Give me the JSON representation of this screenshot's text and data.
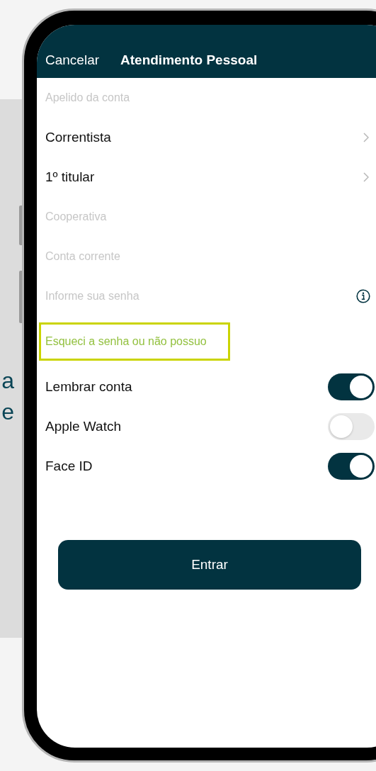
{
  "background_panel": {
    "text_lines": [
      "a",
      "e"
    ]
  },
  "header": {
    "cancel": "Cancelar",
    "title": "Atendimento Pessoal"
  },
  "form_rows": [
    {
      "kind": "input",
      "placeholder": "Apelido da conta"
    },
    {
      "kind": "picker",
      "value": "Correntista"
    },
    {
      "kind": "picker",
      "value": "1º titular"
    },
    {
      "kind": "input",
      "placeholder": "Cooperativa"
    },
    {
      "kind": "input",
      "placeholder": "Conta corrente"
    },
    {
      "kind": "password",
      "placeholder": "Informe sua senha"
    }
  ],
  "forgot_link": {
    "label": "Esqueci a senha ou não possuo",
    "highlighted": true
  },
  "toggles": [
    {
      "label": "Lembrar conta",
      "on": true
    },
    {
      "label": "Apple Watch",
      "on": false
    },
    {
      "label": "Face ID",
      "on": true
    }
  ],
  "submit_button": "Entrar"
}
